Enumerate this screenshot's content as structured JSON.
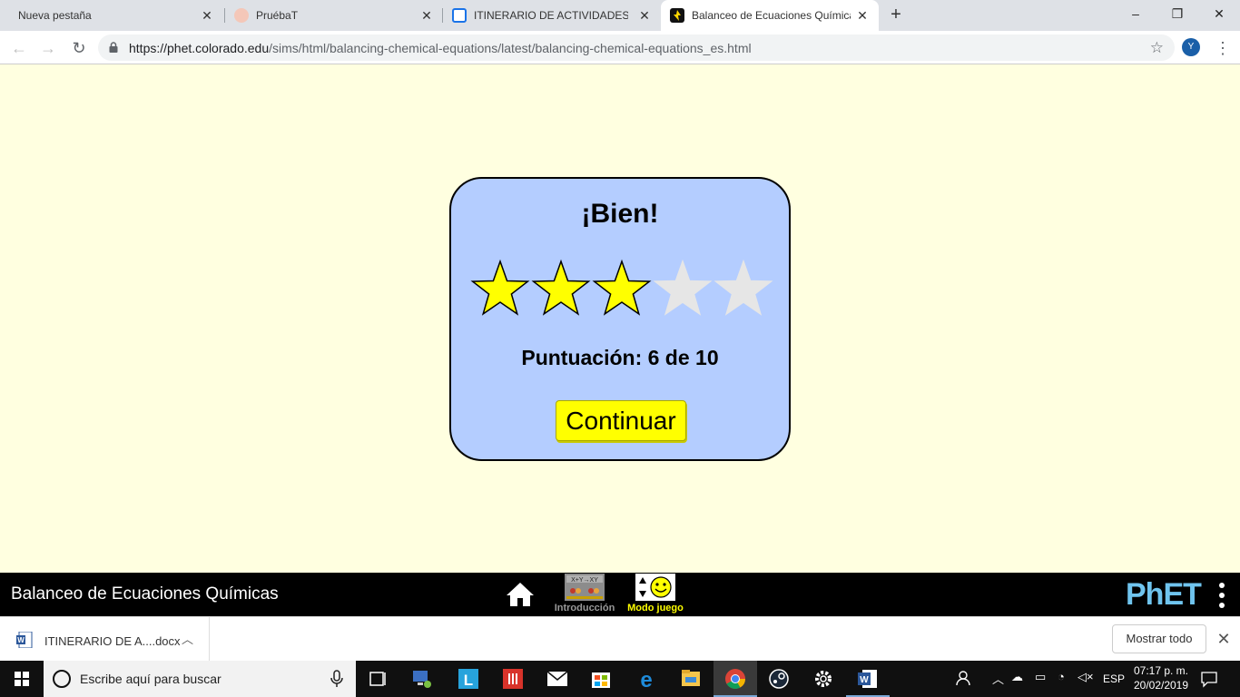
{
  "browser": {
    "tabs": [
      {
        "label": "Nueva pestaña",
        "active": false
      },
      {
        "label": "PruébaT",
        "active": false
      },
      {
        "label": "ITINERARIO DE ACTIVIDADES QU",
        "active": false
      },
      {
        "label": "Balanceo de Ecuaciones Químicas",
        "active": true
      }
    ],
    "url_host": "https://phet.colorado.edu",
    "url_path": "/sims/html/balancing-chemical-equations/latest/balancing-chemical-equations_es.html",
    "profile_initial": "Y"
  },
  "dialog": {
    "title": "¡Bien!",
    "stars_filled": 3,
    "stars_total": 5,
    "score_text": "Puntuación: 6 de 10",
    "continue_label": "Continuar"
  },
  "navbar": {
    "sim_title": "Balanceo de Ecuaciones Químicas",
    "screens": [
      {
        "label": "Introducción",
        "selected": false
      },
      {
        "label": "Modo juego",
        "selected": true
      }
    ],
    "logo_text": "PhET"
  },
  "downloads": {
    "file_name": "ITINERARIO DE A....docx",
    "show_all_label": "Mostrar todo"
  },
  "taskbar": {
    "search_placeholder": "Escribe aquí para buscar",
    "language": "ESP",
    "time": "07:17 p. m.",
    "date": "20/02/2019"
  },
  "colors": {
    "sim_background": "#ffffe0",
    "dialog_background": "#b4cdff",
    "star_filled": "#ffff00",
    "star_empty": "#e6e6e6",
    "button_yellow": "#ffff00",
    "phet_blue": "#6fc4ee",
    "modo_juego_label": "#ffff00",
    "introduccion_label": "#999999"
  }
}
